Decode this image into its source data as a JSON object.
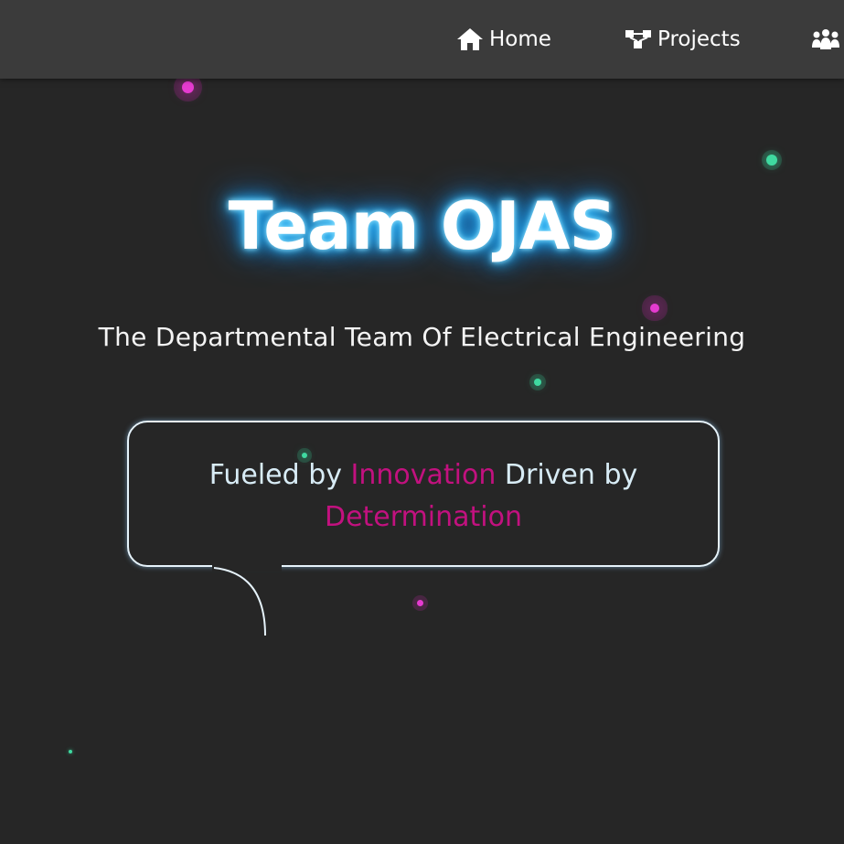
{
  "nav": {
    "items": [
      {
        "label": "Home",
        "icon": "home-icon"
      },
      {
        "label": "Projects",
        "icon": "sitemap-icon"
      },
      {
        "label": "",
        "icon": "team-icon"
      }
    ]
  },
  "hero": {
    "title": "Team OJAS",
    "subtitle": "The Departmental Team Of Electrical Engineering"
  },
  "tagline": {
    "part1": "Fueled by ",
    "accent1": "Innovation",
    "part2": " Driven by ",
    "accent2": "Determination"
  },
  "colors": {
    "background": "#262626",
    "navbar": "#3b3b3b",
    "accent": "#c2117f",
    "glow": "#1aa8ff",
    "particle_pink": "#e53bd0",
    "particle_green": "#3fd9a0"
  }
}
